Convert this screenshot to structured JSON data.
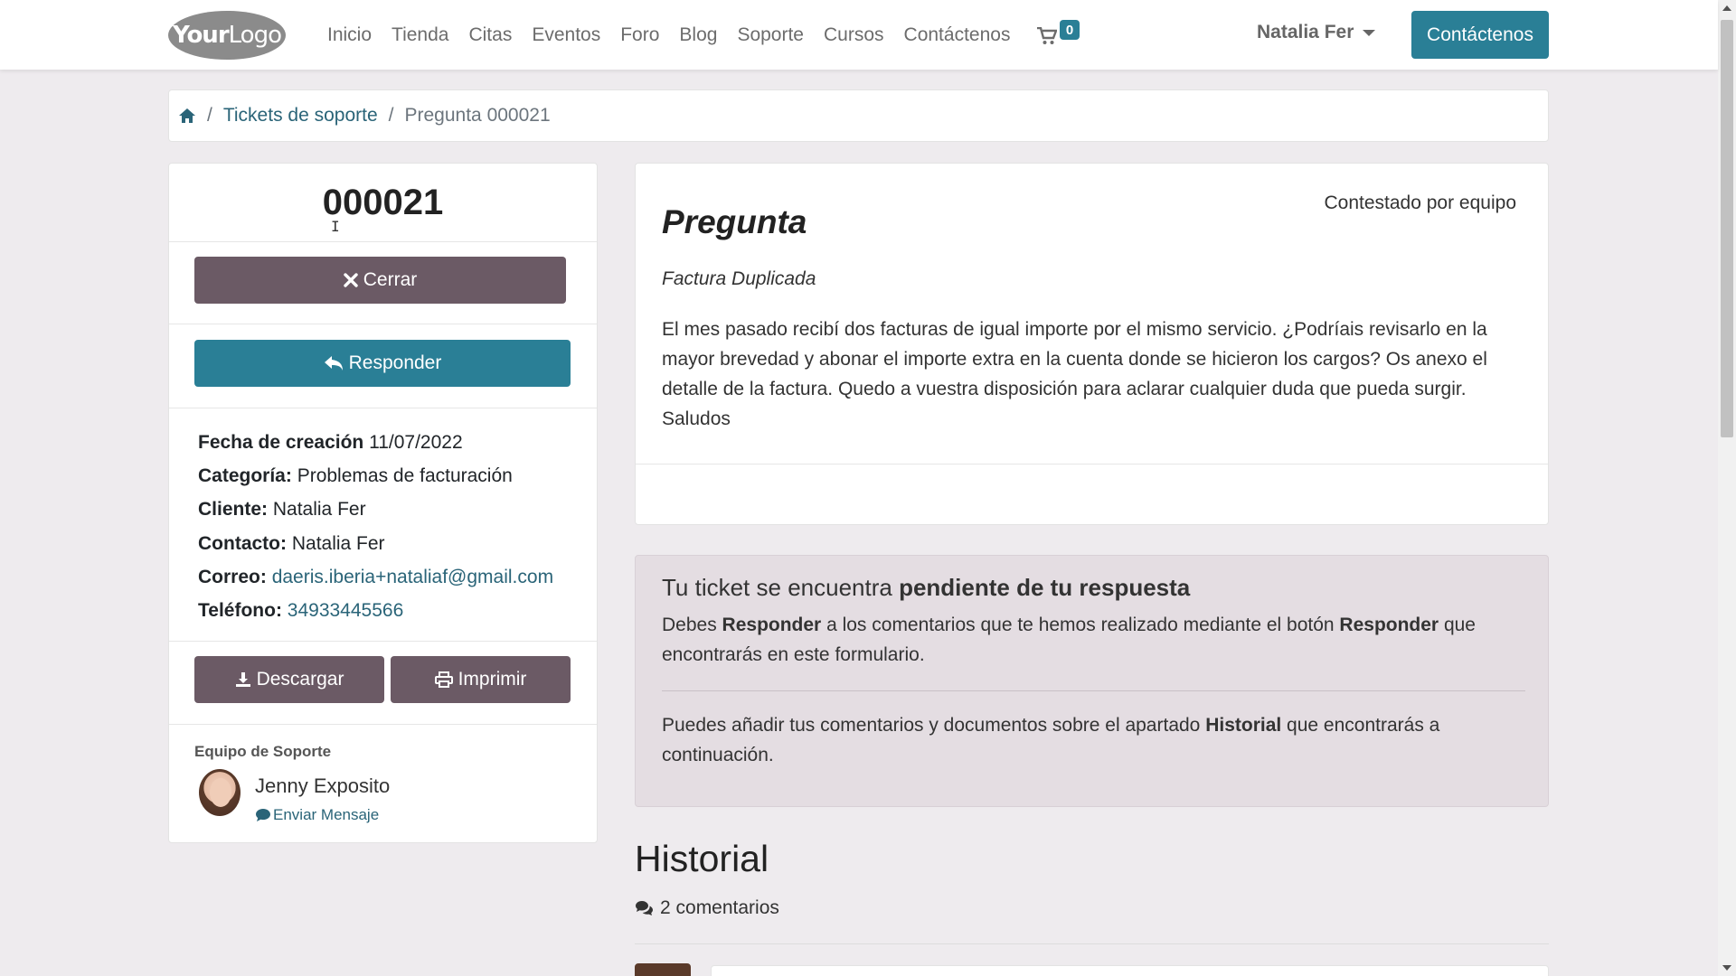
{
  "logo": {
    "bold": "Your",
    "rest": "Logo"
  },
  "nav": {
    "items": [
      "Inicio",
      "Tienda",
      "Citas",
      "Eventos",
      "Foro",
      "Blog",
      "Soporte",
      "Cursos",
      "Contáctenos"
    ],
    "cart_count": "0",
    "user_name": "Natalia Fer",
    "contact_button": "Contáctenos"
  },
  "breadcrumb": {
    "tickets": "Tickets de soporte",
    "current": "Pregunta 000021"
  },
  "ticket": {
    "number": "000021",
    "close_label": "Cerrar",
    "reply_label": "Responder",
    "info": {
      "created_label": "Fecha de creación",
      "created_value": "11/07/2022",
      "category_label": "Categoría:",
      "category_value": "Problemas de facturación",
      "client_label": "Cliente:",
      "client_value": "Natalia Fer",
      "contact_label": "Contacto:",
      "contact_value": "Natalia Fer",
      "email_label": "Correo:",
      "email_value": "daeris.iberia+nataliaf@gmail.com",
      "phone_label": "Teléfono:",
      "phone_value": "34933445566"
    },
    "download_label": "Descargar",
    "print_label": "Imprimir",
    "team_label": "Equipo de Soporte",
    "agent_name": "Jenny Exposito",
    "send_message": "Enviar Mensaje"
  },
  "question": {
    "title": "Pregunta",
    "status": "Contestado por equipo",
    "subject": "Factura Duplicada",
    "body": "El mes pasado recibí dos facturas de igual importe por el mismo servicio. ¿Podríais revisarlo en la mayor brevedad y abonar el importe extra en la cuenta donde se hicieron los cargos? Os anexo el detalle de la factura. Quedo a vuestra disposición para aclarar cualquier duda que pueda surgir. Saludos"
  },
  "alert": {
    "title_pre": "Tu ticket se encuentra ",
    "title_bold": "pendiente de tu respuesta",
    "p1_a": "Debes ",
    "p1_b": "Responder",
    "p1_c": " a los comentarios que te hemos realizado mediante el botón ",
    "p1_d": "Responder",
    "p1_e": " que encontrarás en este formulario.",
    "p2_a": "Puedes añadir tus comentarios y documentos sobre el apartado ",
    "p2_b": "Historial",
    "p2_c": " que encontrarás a continuación."
  },
  "history": {
    "title": "Historial",
    "count": "2 comentarios"
  },
  "colors": {
    "primary": "#2a7f96",
    "secondary": "#6b5a65",
    "alert_bg": "#e4dde2",
    "page_bg": "#eeebee"
  }
}
